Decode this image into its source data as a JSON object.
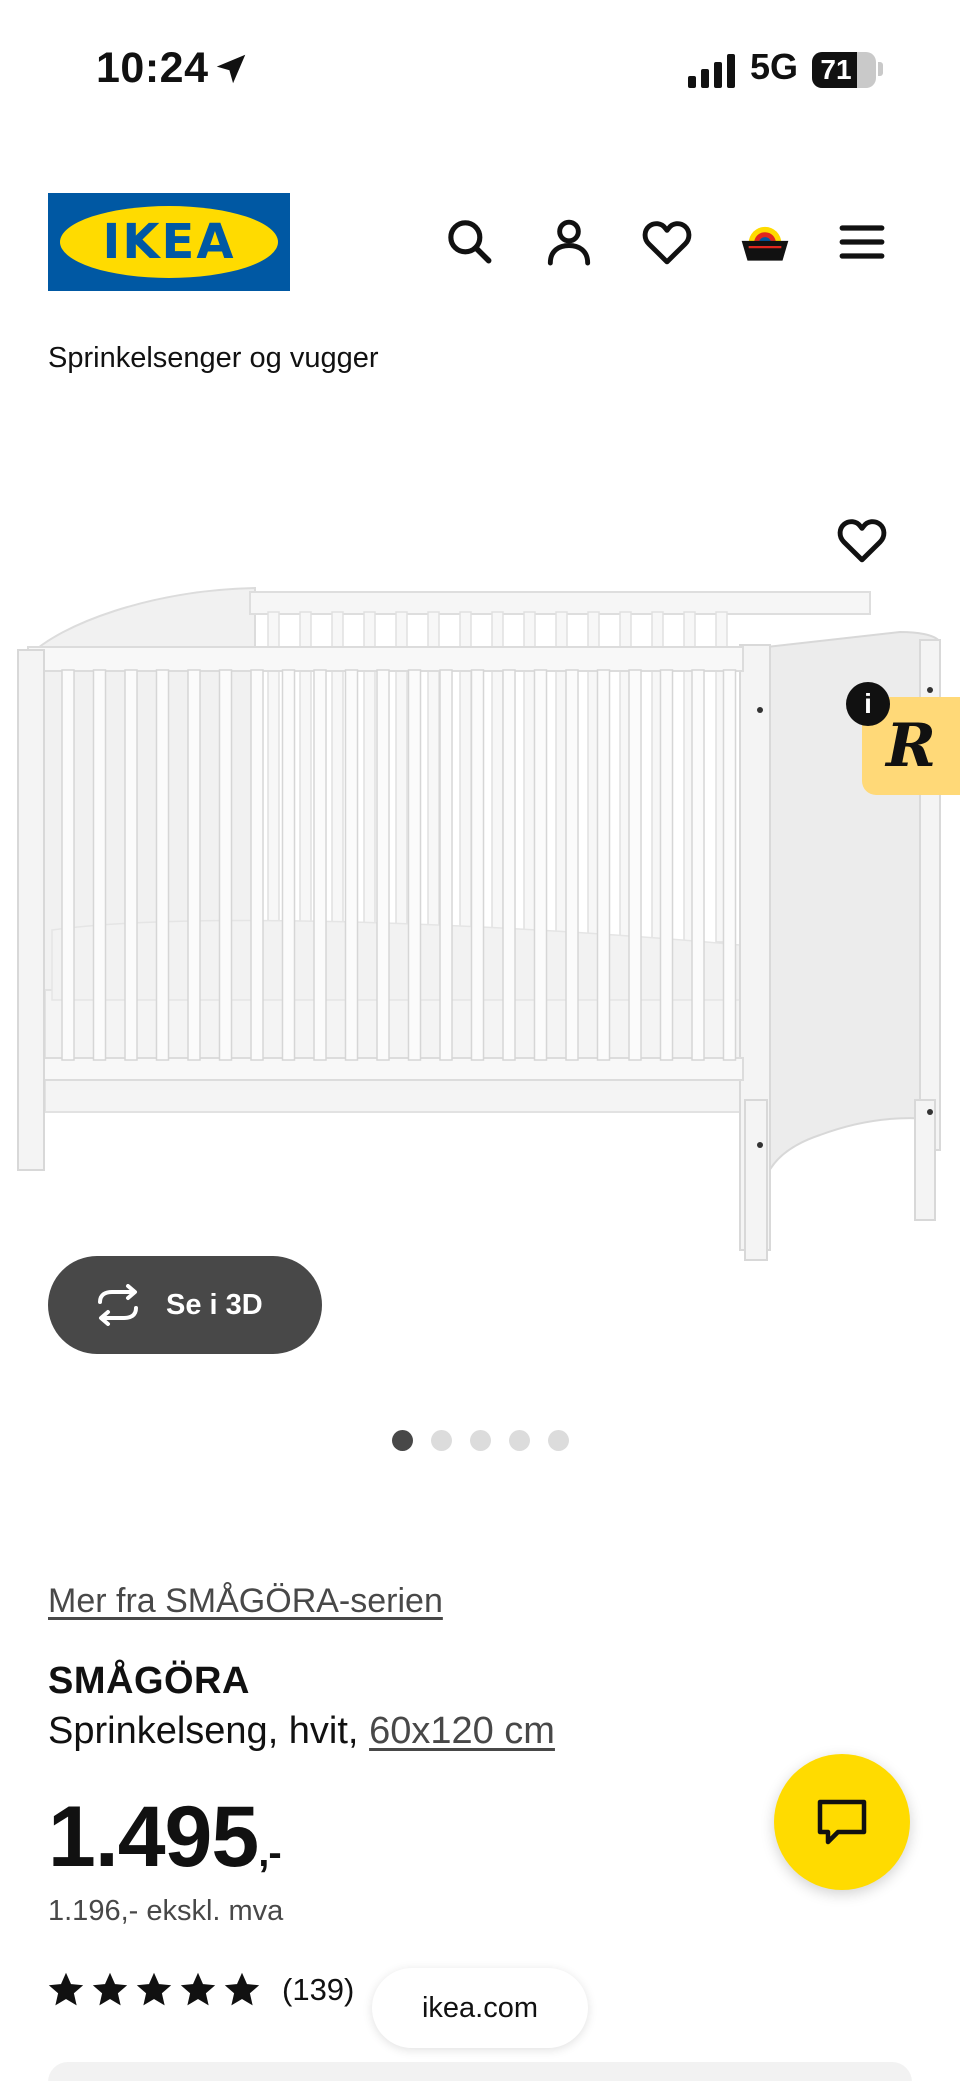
{
  "status_bar": {
    "time": "10:24",
    "network": "5G",
    "battery_level": "71",
    "battery_fraction": 0.71
  },
  "header": {
    "logo_text": "IKEA",
    "icons": [
      "search-icon",
      "account-icon",
      "heart-icon",
      "basket-icon",
      "menu-icon"
    ]
  },
  "breadcrumb": "Sprinkelsenger og vugger",
  "gallery": {
    "view_3d_label": "Se i 3D",
    "slide_count": 5,
    "active_slide": 1,
    "badge_info": "i",
    "badge_letter": "R"
  },
  "product": {
    "series_link": "Mer fra SMÅGÖRA-serien",
    "name": "SMÅGÖRA",
    "description": "Sprinkelseng, hvit, ",
    "size": "60x120 cm",
    "price": "1.495",
    "price_suffix": ",-",
    "price_ex_vat": "1.196,- ekskl. mva",
    "rating": 5,
    "review_count": "(139)"
  },
  "browser": {
    "url": "ikea.com"
  },
  "colors": {
    "ikea_blue": "#0058a3",
    "ikea_yellow": "#ffdb00",
    "dark_gray": "#484848",
    "badge_yellow": "#ffd978"
  }
}
